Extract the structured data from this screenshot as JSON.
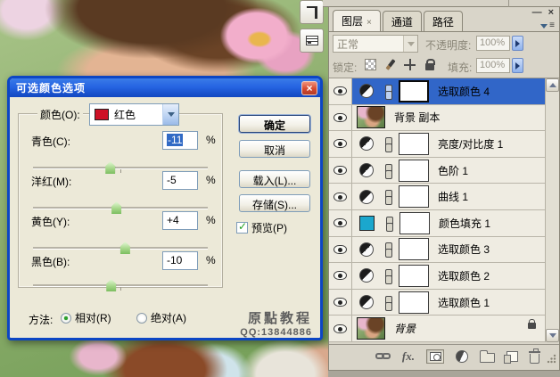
{
  "dialog": {
    "title": "可选颜色选项",
    "close_glyph": "×",
    "color_label": "颜色(O):",
    "color_value": "红色",
    "fields": [
      {
        "label": "青色(C):",
        "value": "-11",
        "unit": "%"
      },
      {
        "label": "洋红(M):",
        "value": "-5",
        "unit": "%"
      },
      {
        "label": "黄色(Y):",
        "value": "+4",
        "unit": "%"
      },
      {
        "label": "黑色(B):",
        "value": "-10",
        "unit": "%"
      }
    ],
    "buttons": {
      "ok": "确定",
      "cancel": "取消",
      "load": "载入(L)...",
      "save": "存储(S)..."
    },
    "preview_label": "预览(P)",
    "method_label": "方法:",
    "method_options": [
      {
        "label": "相对(R)",
        "selected": true
      },
      {
        "label": "绝对(A)",
        "selected": false
      }
    ],
    "watermark": {
      "line1": "原點教程",
      "line2": "QQ:13844886"
    }
  },
  "panel": {
    "window": {
      "minimize": "—",
      "close": "×"
    },
    "tabs": [
      {
        "label": "图层",
        "close": "×",
        "active": true
      },
      {
        "label": "通道",
        "active": false
      },
      {
        "label": "路径",
        "active": false
      }
    ],
    "blend_mode": "正常",
    "opacity_label": "不透明度:",
    "opacity_value": "100%",
    "lock_label": "锁定:",
    "fill_label": "填充:",
    "fill_value": "100%",
    "layers": [
      {
        "name": "选取颜色 4",
        "type": "adjustment",
        "selected": true
      },
      {
        "name": "背景 副本",
        "type": "image"
      },
      {
        "name": "亮度/对比度 1",
        "type": "adjustment"
      },
      {
        "name": "色阶 1",
        "type": "adjustment"
      },
      {
        "name": "曲线 1",
        "type": "adjustment"
      },
      {
        "name": "颜色填充 1",
        "type": "fill",
        "swatch": "#1BA7CD"
      },
      {
        "name": "选取颜色 3",
        "type": "adjustment"
      },
      {
        "name": "选取颜色 2",
        "type": "adjustment"
      },
      {
        "name": "选取颜色 1",
        "type": "adjustment"
      },
      {
        "name": "背景",
        "type": "image",
        "locked": true
      }
    ],
    "toolbar": {
      "fx_label": "fx."
    }
  },
  "colors": {
    "selection_blue": "#3166C8",
    "fill_swatch": "#1BA7CD",
    "dialog_title_blue": "#2664E2",
    "close_red": "#D6492F",
    "color_swatch_red": "#CE1126"
  }
}
